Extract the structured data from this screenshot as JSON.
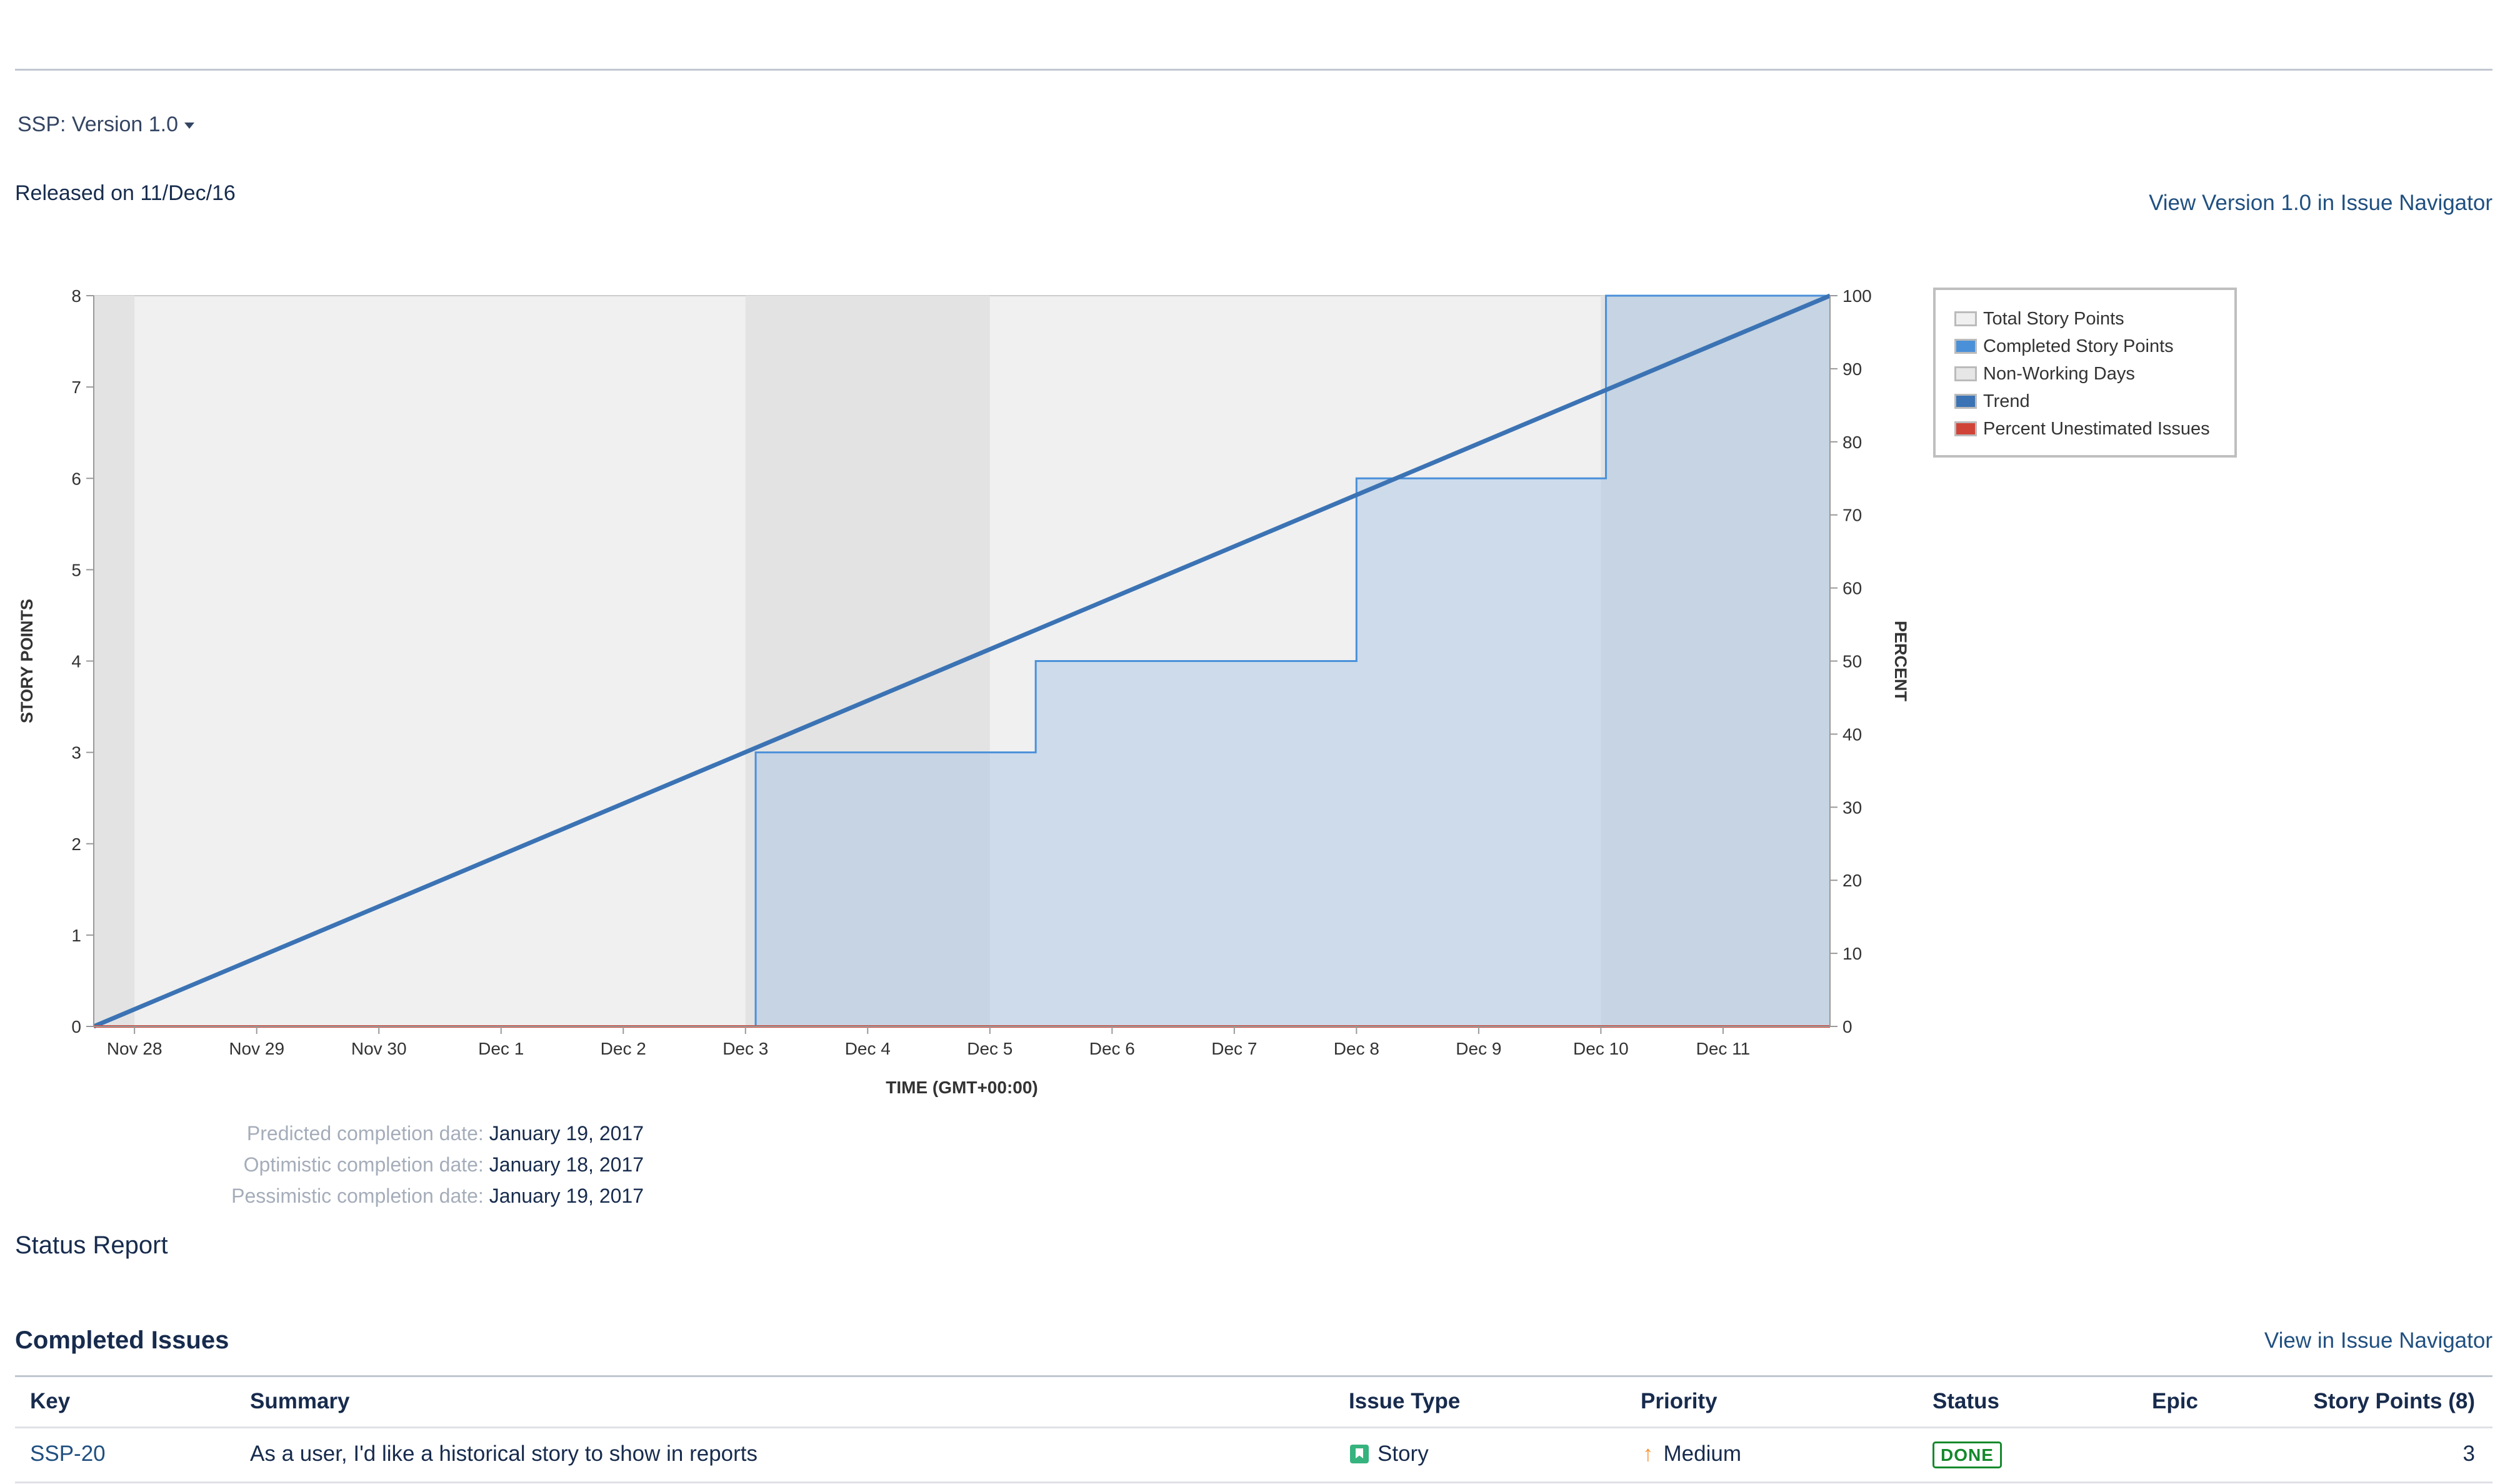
{
  "header": {
    "version_select": "SSP: Version 1.0",
    "released": "Released on 11/Dec/16",
    "view_version_link": "View Version 1.0 in Issue Navigator"
  },
  "chart_data": {
    "type": "area",
    "title": "",
    "ylabel": "STORY POINTS",
    "y2label": "PERCENT",
    "xlabel": "TIME (GMT+00:00)",
    "ylim": [
      0,
      8
    ],
    "y2lim": [
      0,
      100
    ],
    "y_ticks": [
      "0",
      "1",
      "2",
      "3",
      "4",
      "5",
      "6",
      "7",
      "8"
    ],
    "y2_ticks": [
      "0",
      "10",
      "20",
      "30",
      "40",
      "50",
      "60",
      "70",
      "80",
      "90",
      "100"
    ],
    "x_ticks": [
      "Nov 28",
      "Nov 29",
      "Nov 30",
      "Dec 1",
      "Dec 2",
      "Dec 3",
      "Dec 4",
      "Dec 5",
      "Dec 6",
      "Dec 7",
      "Dec 8",
      "Dec 9",
      "Dec 10",
      "Dec 11"
    ],
    "x_start": "2016-11-27T16:00",
    "x_end": "2016-12-11T21:00",
    "non_working_days": [
      [
        "2016-11-27T16:00",
        "2016-11-28T00:00"
      ],
      [
        "2016-12-03T00:00",
        "2016-12-05T00:00"
      ],
      [
        "2016-12-10T00:00",
        "2016-12-11T21:00"
      ]
    ],
    "completed_story_points": [
      {
        "x": "2016-11-27T16:00",
        "y": 0
      },
      {
        "x": "2016-12-03T02:00",
        "y": 3
      },
      {
        "x": "2016-12-05T09:00",
        "y": 4
      },
      {
        "x": "2016-12-08T00:00",
        "y": 6
      },
      {
        "x": "2016-12-10T01:00",
        "y": 8
      }
    ],
    "trend": [
      {
        "x": "2016-11-27T16:00",
        "y": 0
      },
      {
        "x": "2016-12-11T21:00",
        "y": 8
      }
    ],
    "percent_unestimated": [
      {
        "x": "2016-11-27T16:00",
        "y": 0
      },
      {
        "x": "2016-12-11T21:00",
        "y": 0
      }
    ],
    "legend": {
      "position": "top-right",
      "items": [
        {
          "label": "Total Story Points",
          "color": "#f0f0f0"
        },
        {
          "label": "Completed Story Points",
          "color": "#4a90d9"
        },
        {
          "label": "Non-Working Days",
          "color": "#e6e6e6"
        },
        {
          "label": "Trend",
          "color": "#3b73b4"
        },
        {
          "label": "Percent Unestimated Issues",
          "color": "#d04437"
        }
      ]
    }
  },
  "predictions": [
    {
      "label": "Predicted completion date:",
      "value": "January 19, 2017"
    },
    {
      "label": "Optimistic completion date:",
      "value": "January 18, 2017"
    },
    {
      "label": "Pessimistic completion date:",
      "value": "January 19, 2017"
    }
  ],
  "status_report": "Status Report",
  "completed": {
    "title": "Completed Issues",
    "view_link": "View in Issue Navigator",
    "columns": {
      "key": "Key",
      "summary": "Summary",
      "issue_type": "Issue Type",
      "priority": "Priority",
      "status": "Status",
      "epic": "Epic",
      "story_points": "Story Points (8)"
    },
    "rows": [
      {
        "key": "SSP-20",
        "summary": "As a user, I'd like a historical story to show in reports",
        "issue_type": "Story",
        "priority": "Medium",
        "status": "DONE",
        "epic": "",
        "story_points": "3"
      }
    ]
  }
}
